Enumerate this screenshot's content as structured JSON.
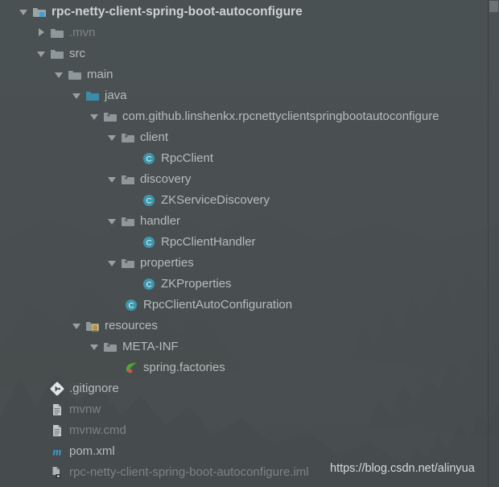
{
  "panel": {
    "name": "project-tool-window",
    "background_color": "#4a5052",
    "text_color": "#b7bcbd",
    "dim_text_color": "#7e8486"
  },
  "watermark": {
    "text": "https://blog.csdn.net/alinyua"
  },
  "scrollbar": {
    "thumb_color": "#6d7375"
  },
  "tree": {
    "rows": [
      {
        "label": "rpc-netty-client-spring-boot-autoconfigure",
        "icon": "module-folder-icon",
        "arrow": "open",
        "indent": 0,
        "style": "root"
      },
      {
        "label": ".mvn",
        "icon": "folder-icon",
        "arrow": "closed",
        "indent": 1,
        "style": "dim"
      },
      {
        "label": "src",
        "icon": "folder-icon",
        "arrow": "open",
        "indent": 1,
        "style": "normal"
      },
      {
        "label": "main",
        "icon": "folder-icon",
        "arrow": "open",
        "indent": 2,
        "style": "normal"
      },
      {
        "label": "java",
        "icon": "source-root-folder-icon",
        "arrow": "open",
        "indent": 3,
        "style": "normal"
      },
      {
        "label": "com.github.linshenkx.rpcnettyclientspringbootautoconfigure",
        "icon": "package-icon",
        "arrow": "open",
        "indent": 4,
        "style": "normal"
      },
      {
        "label": "client",
        "icon": "package-icon",
        "arrow": "open",
        "indent": 5,
        "style": "normal"
      },
      {
        "label": "RpcClient",
        "icon": "java-class-icon",
        "arrow": "none",
        "indent": 6,
        "style": "normal"
      },
      {
        "label": "discovery",
        "icon": "package-icon",
        "arrow": "open",
        "indent": 5,
        "style": "normal"
      },
      {
        "label": "ZKServiceDiscovery",
        "icon": "java-class-icon",
        "arrow": "none",
        "indent": 6,
        "style": "normal"
      },
      {
        "label": "handler",
        "icon": "package-icon",
        "arrow": "open",
        "indent": 5,
        "style": "normal"
      },
      {
        "label": "RpcClientHandler",
        "icon": "java-class-icon",
        "arrow": "none",
        "indent": 6,
        "style": "normal"
      },
      {
        "label": "properties",
        "icon": "package-icon",
        "arrow": "open",
        "indent": 5,
        "style": "normal"
      },
      {
        "label": "ZKProperties",
        "icon": "java-class-icon",
        "arrow": "none",
        "indent": 6,
        "style": "normal"
      },
      {
        "label": "RpcClientAutoConfiguration",
        "icon": "java-class-icon",
        "arrow": "none",
        "indent": 5,
        "style": "normal"
      },
      {
        "label": "resources",
        "icon": "resource-root-folder-icon",
        "arrow": "open",
        "indent": 3,
        "style": "normal"
      },
      {
        "label": "META-INF",
        "icon": "package-icon",
        "arrow": "open",
        "indent": 4,
        "style": "normal"
      },
      {
        "label": "spring.factories",
        "icon": "spring-leaf-icon",
        "arrow": "none",
        "indent": 5,
        "style": "normal"
      },
      {
        "label": ".gitignore",
        "icon": "git-icon",
        "arrow": "none",
        "indent": 1,
        "style": "normal"
      },
      {
        "label": "mvnw",
        "icon": "file-icon",
        "arrow": "none",
        "indent": 1,
        "style": "dim"
      },
      {
        "label": "mvnw.cmd",
        "icon": "file-icon",
        "arrow": "none",
        "indent": 1,
        "style": "dim"
      },
      {
        "label": "pom.xml",
        "icon": "maven-icon",
        "arrow": "none",
        "indent": 1,
        "style": "normal"
      },
      {
        "label": "rpc-netty-client-spring-boot-autoconfigure.iml",
        "icon": "iml-icon",
        "arrow": "none",
        "indent": 1,
        "style": "dim"
      }
    ]
  }
}
